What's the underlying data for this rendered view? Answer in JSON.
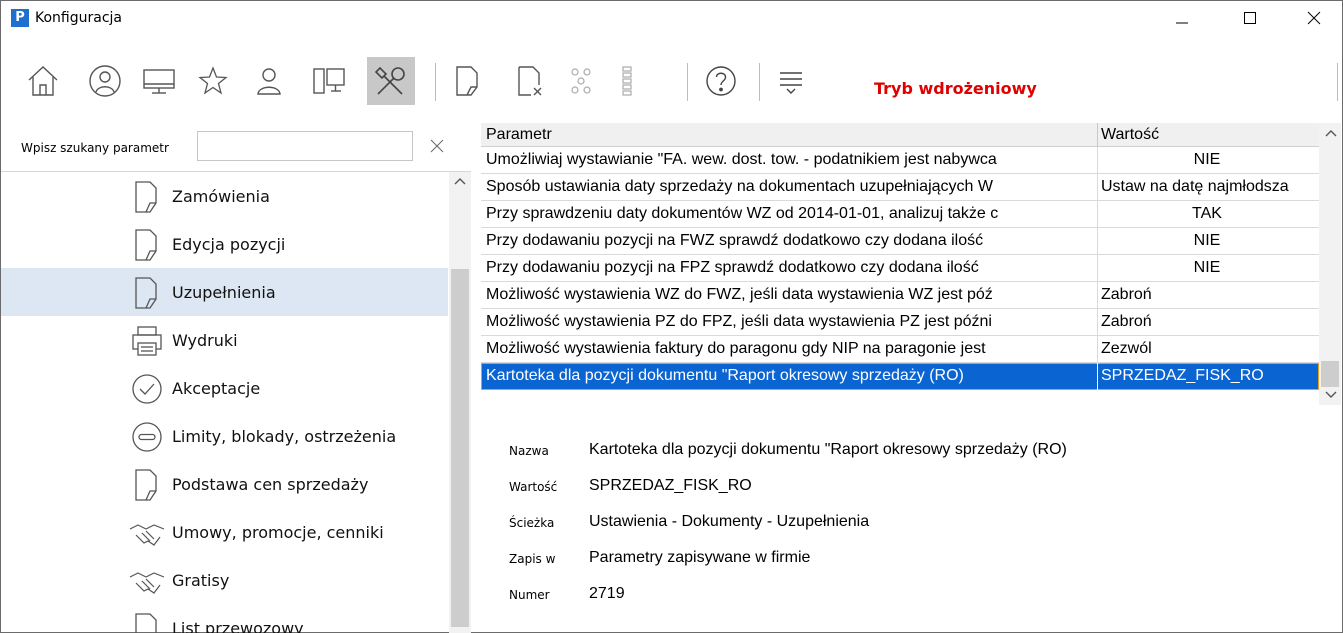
{
  "window": {
    "title": "Konfiguracja",
    "app_icon_letter": "P"
  },
  "toolbar": {
    "mode_label": "Tryb wdrożeniowy",
    "icons": [
      "home-icon",
      "user-circle-icon",
      "monitor-icon",
      "star-icon",
      "person-icon",
      "devices-icon",
      "tools-icon",
      "document-arrow-icon",
      "document-delete-icon",
      "group-icon",
      "list-icon",
      "help-icon",
      "menu-icon"
    ]
  },
  "search": {
    "label": "Wpisz szukany parametr",
    "value": "",
    "placeholder": ""
  },
  "tree": {
    "items": [
      {
        "label": "Zamówienia",
        "icon": "document-icon"
      },
      {
        "label": "Edycja pozycji",
        "icon": "document-icon"
      },
      {
        "label": "Uzupełnienia",
        "icon": "document-icon",
        "selected": true
      },
      {
        "label": "Wydruki",
        "icon": "printer-icon"
      },
      {
        "label": "Akceptacje",
        "icon": "check-circle-icon"
      },
      {
        "label": "Limity, blokady, ostrzeżenia",
        "icon": "minus-circle-icon"
      },
      {
        "label": "Podstawa cen sprzedaży",
        "icon": "document-icon"
      },
      {
        "label": "Umowy, promocje, cenniki",
        "icon": "handshake-icon"
      },
      {
        "label": "Gratisy",
        "icon": "handshake-icon"
      },
      {
        "label": "List przewozowy",
        "icon": "document-icon"
      }
    ]
  },
  "grid": {
    "columns": [
      "Parametr",
      "Wartość"
    ],
    "rows": [
      {
        "param": "Umożliwiaj wystawianie \"FA. wew. dost. tow. - podatnikiem jest nabywca",
        "value": "NIE",
        "center": true
      },
      {
        "param": "Sposób ustawiania daty sprzedaży na dokumentach uzupełniających W",
        "value": "Ustaw na datę najmłodsza",
        "center": false
      },
      {
        "param": "Przy sprawdzeniu daty dokumentów WZ od 2014-01-01, analizuj także c",
        "value": "TAK",
        "center": true
      },
      {
        "param": "Przy dodawaniu pozycji na FWZ sprawdź dodatkowo czy dodana ilość",
        "value": "NIE",
        "center": true
      },
      {
        "param": "Przy dodawaniu pozycji na FPZ sprawdź dodatkowo czy dodana ilość",
        "value": "NIE",
        "center": true
      },
      {
        "param": "Możliwość wystawienia WZ do FWZ, jeśli data wystawienia WZ jest póź",
        "value": "Zabroń",
        "center": false
      },
      {
        "param": "Możliwość wystawienia PZ do FPZ, jeśli data wystawienia PZ jest późni",
        "value": "Zabroń",
        "center": false
      },
      {
        "param": "Możliwość wystawienia faktury do paragonu gdy NIP na paragonie jest",
        "value": "Zezwól",
        "center": false
      },
      {
        "param": "Kartoteka dla pozycji dokumentu \"Raport okresowy sprzedaży (RO)",
        "value": "SPRZEDAZ_FISK_RO",
        "center": false,
        "selected": true
      }
    ]
  },
  "details": {
    "rows": [
      {
        "key": "Nazwa",
        "value": "Kartoteka dla pozycji dokumentu \"Raport okresowy sprzedaży (RO)"
      },
      {
        "key": "Wartość",
        "value": "SPRZEDAZ_FISK_RO"
      },
      {
        "key": "Ścieżka",
        "value": "Ustawienia - Dokumenty - Uzupełnienia"
      },
      {
        "key": "Zapis w",
        "value": "Parametry zapisywane w firmie"
      },
      {
        "key": "Numer",
        "value": "2719"
      }
    ]
  }
}
